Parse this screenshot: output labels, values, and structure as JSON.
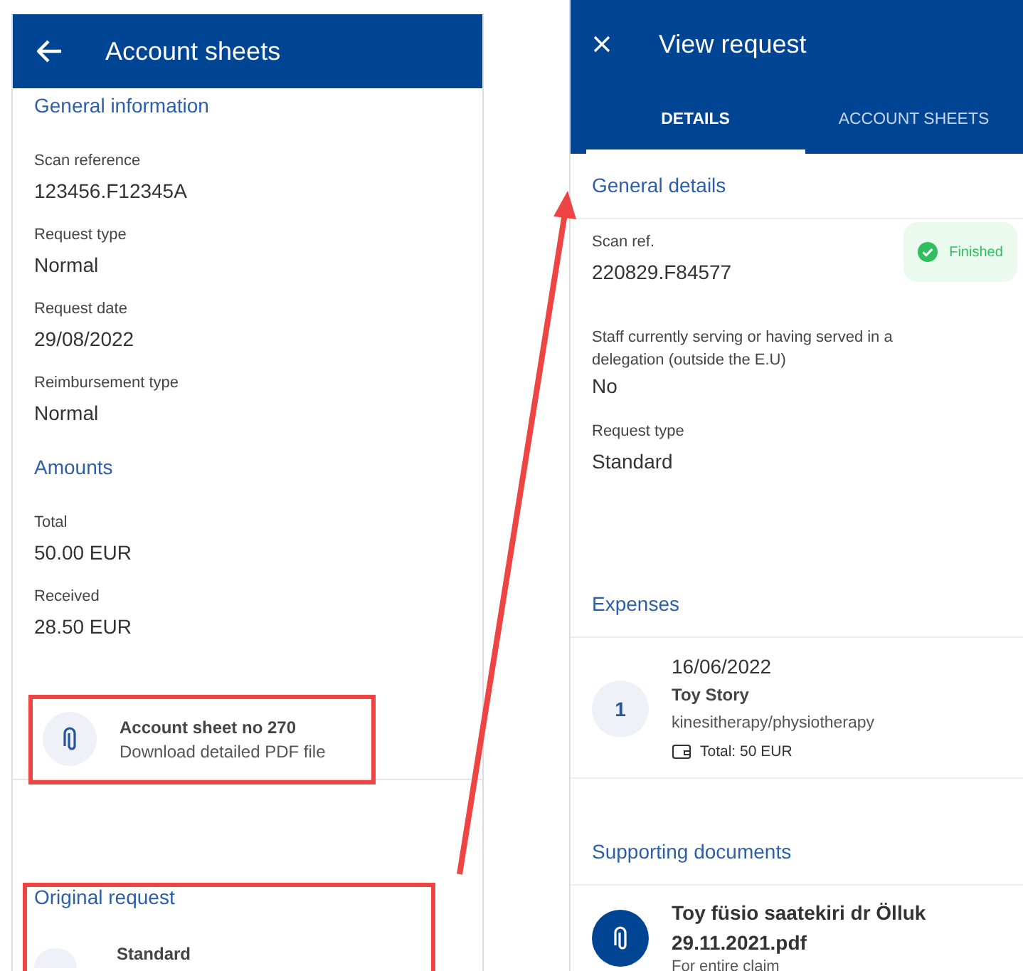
{
  "left_panel": {
    "title": "Account sheets",
    "sections": [
      {
        "heading": "General information",
        "fields": [
          {
            "label": "Scan reference",
            "value": "123456.F12345A"
          },
          {
            "label": "Request type",
            "value": "Normal"
          },
          {
            "label": "Request date",
            "value": "29/08/2022"
          },
          {
            "label": "Reimbursement type",
            "value": "Normal"
          }
        ]
      },
      {
        "heading": "Amounts",
        "fields": [
          {
            "label": "Total",
            "value": "50.00 EUR"
          },
          {
            "label": "Received",
            "value": "28.50 EUR"
          }
        ]
      }
    ],
    "attachment": {
      "title": "Account sheet no 270",
      "subtitle": "Download detailed PDF file"
    },
    "original_request": {
      "heading": "Original request",
      "item": "Standard"
    }
  },
  "right_panel": {
    "title": "View request",
    "tabs": [
      {
        "label": "DETAILS",
        "selected": true
      },
      {
        "label": "ACCOUNT SHEETS",
        "selected": false
      }
    ],
    "general_details": {
      "heading": "General details",
      "status": "Finished",
      "fields": [
        {
          "label": "Scan ref.",
          "value": "220829.F84577"
        },
        {
          "label": "Staff currently serving or having served in a delegation (outside the E.U)",
          "value": "No"
        },
        {
          "label": "Request type",
          "value": "Standard"
        }
      ]
    },
    "expenses": {
      "heading": "Expenses",
      "items": [
        {
          "number": "1",
          "date": "16/06/2022",
          "name": "Toy Story",
          "category": "kinesitherapy/physiotherapy",
          "total": "Total: 50 EUR"
        }
      ]
    },
    "supporting_documents": {
      "heading": "Supporting documents",
      "items": [
        {
          "name": "Toy füsio saatekiri dr Ölluk 29.11.2021.pdf",
          "scope": "For entire claim"
        }
      ]
    }
  }
}
